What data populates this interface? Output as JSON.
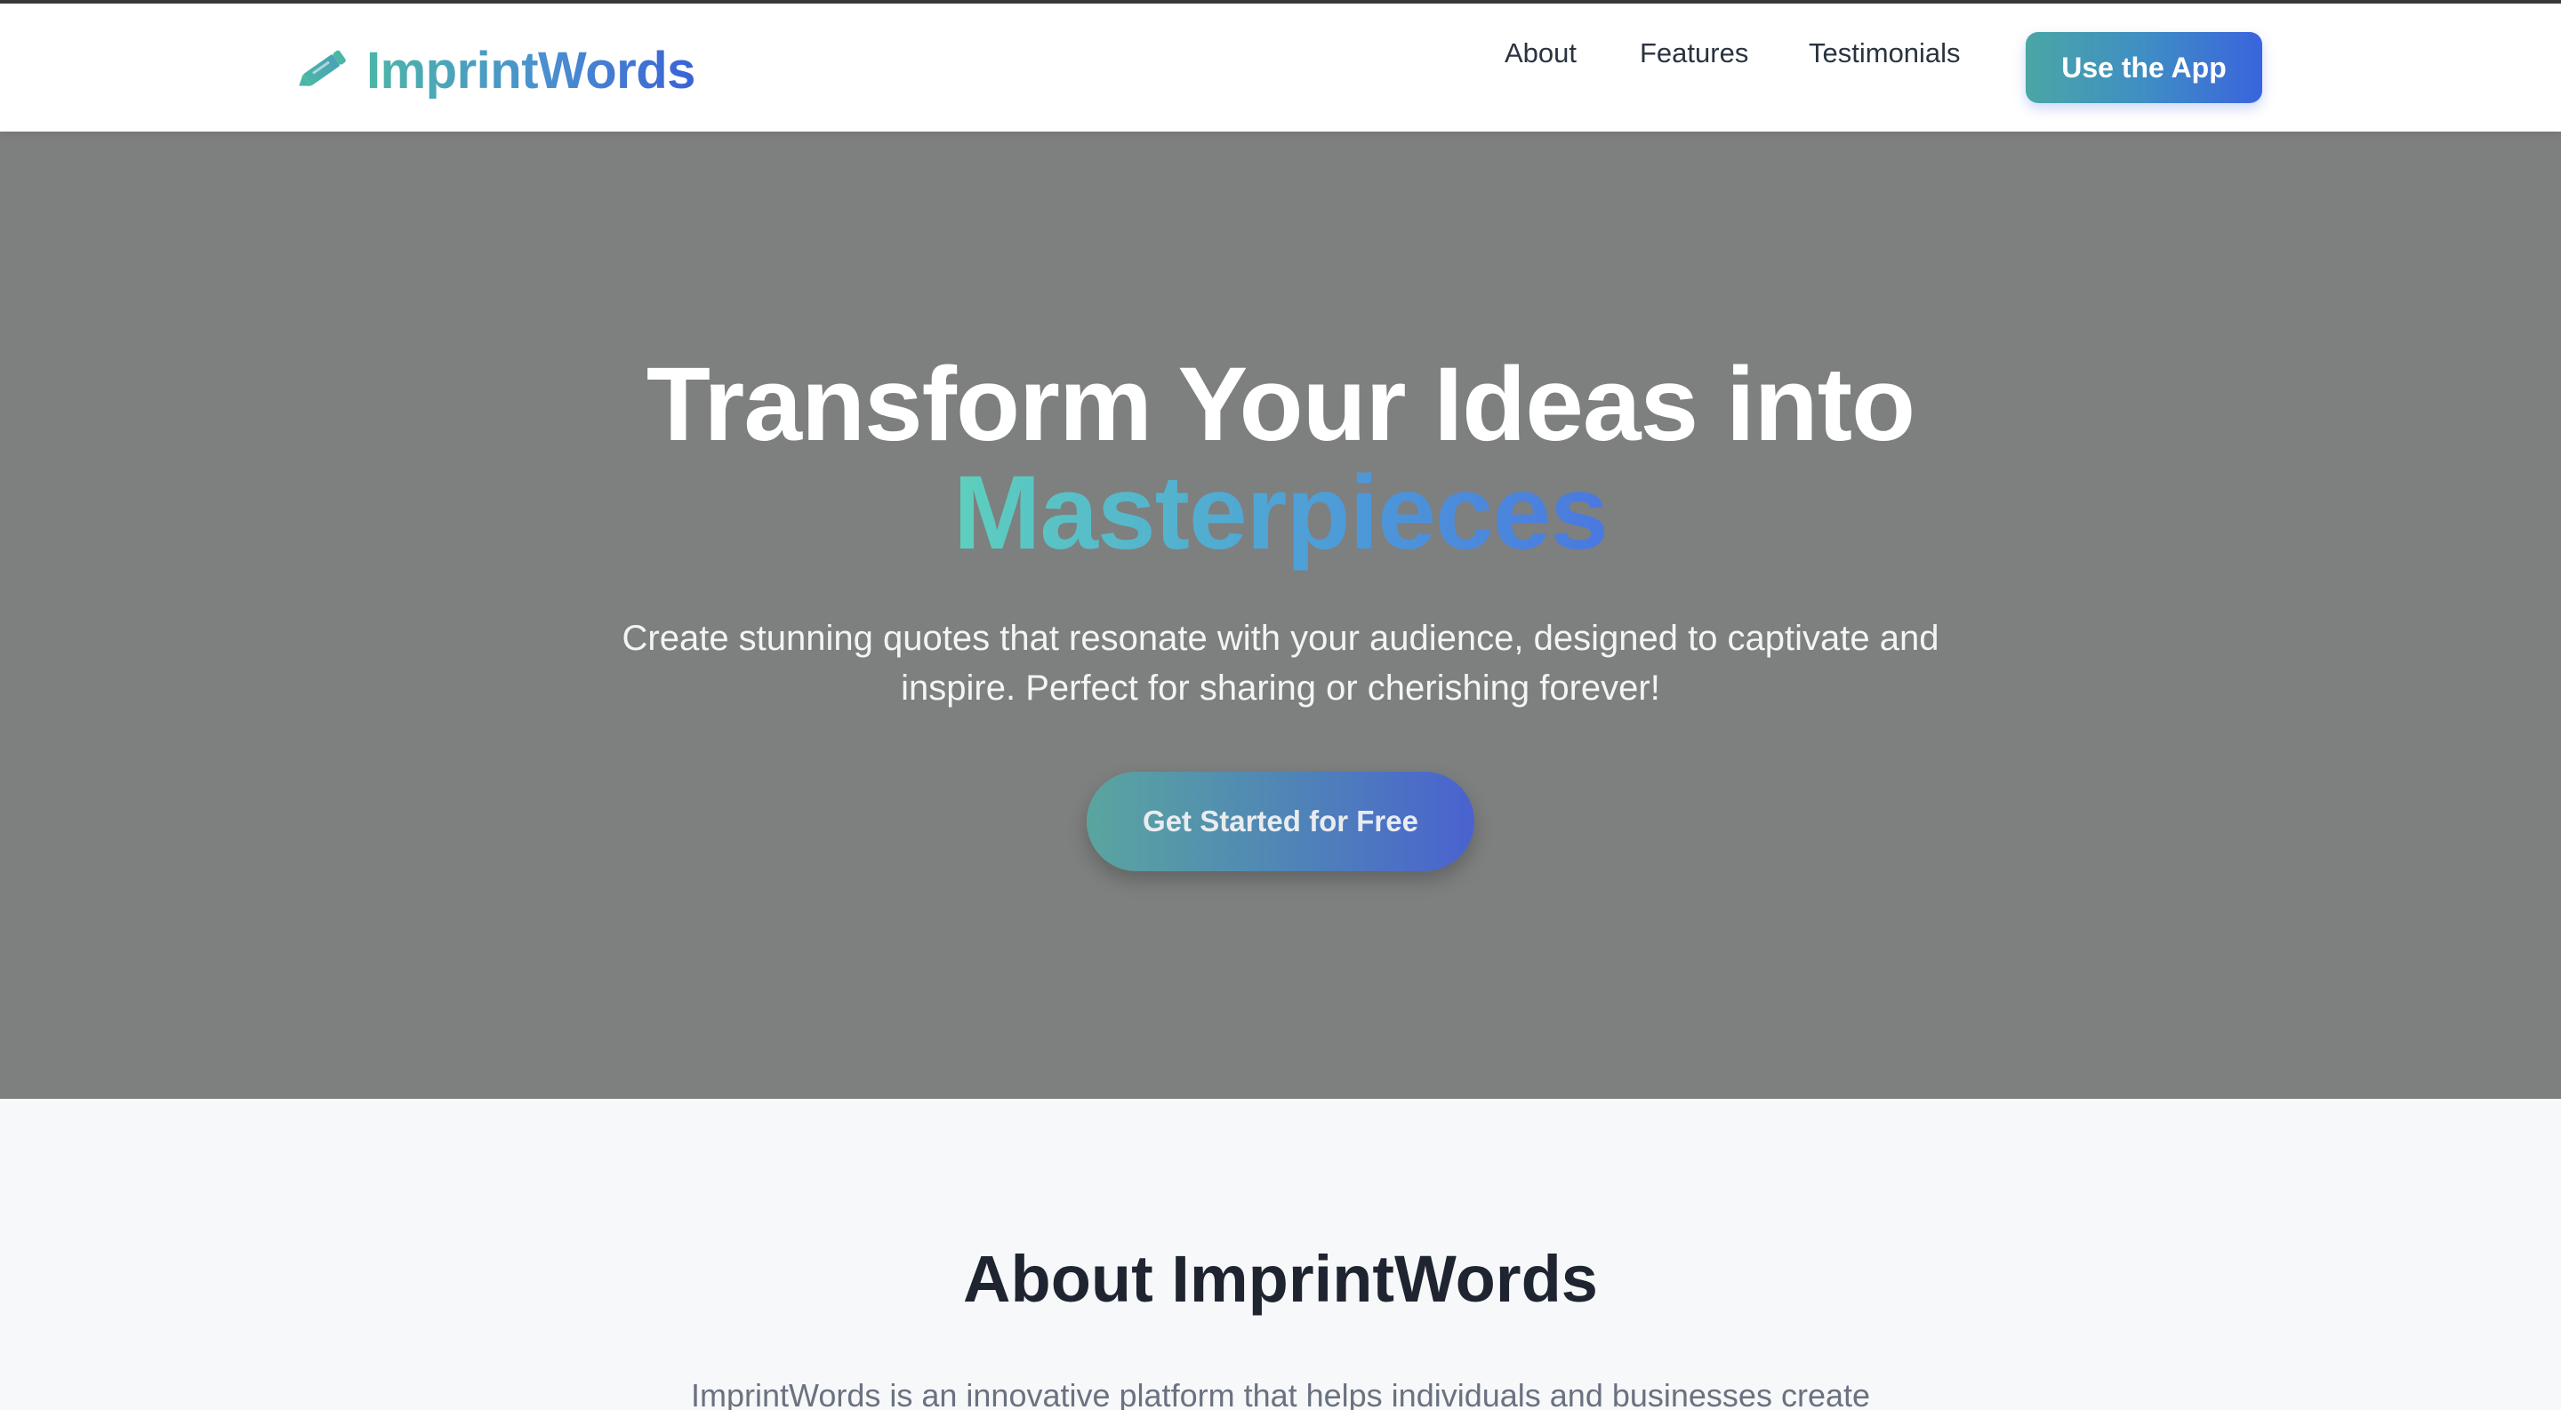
{
  "brand": {
    "name": "ImprintWords",
    "icon": "pencil-icon"
  },
  "nav": {
    "items": [
      {
        "label": "About"
      },
      {
        "label": "Features"
      },
      {
        "label": "Testimonials"
      }
    ],
    "cta_label": "Use the App"
  },
  "hero": {
    "title_line1": "Transform Your Ideas into",
    "title_highlight": "Masterpieces",
    "subtitle_line1": "Create stunning quotes that resonate with your audience, designed to captivate and",
    "subtitle_line2": "inspire. Perfect for sharing or cherishing forever!",
    "cta_label": "Get Started for Free"
  },
  "about": {
    "title": "About ImprintWords",
    "intro_peek": "ImprintWords is an innovative platform that helps individuals and businesses create"
  },
  "colors": {
    "accent_teal": "#4cb6a6",
    "accent_blue": "#3a62d6",
    "hero_bg": "#7e7f7f",
    "page_bg": "#f7f8fa",
    "text_dark": "#1f2530"
  }
}
